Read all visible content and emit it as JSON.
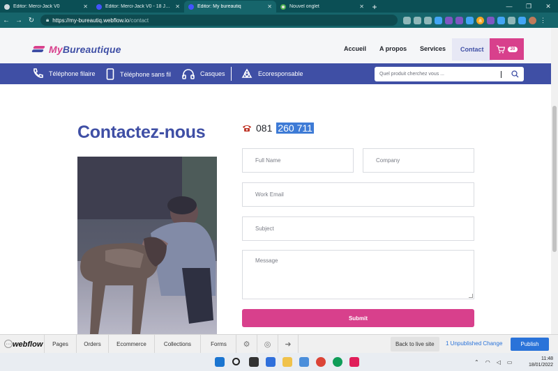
{
  "browser": {
    "tabs": [
      {
        "title": "Editor: Merci-Jack V0",
        "active": false
      },
      {
        "title": "Editor: Merci-Jack V0 - 18 Januar",
        "active": false
      },
      {
        "title": "Editor: My bureautiq",
        "active": true
      },
      {
        "title": "Nouvel onglet",
        "active": false
      }
    ],
    "url_host": "https://my-bureautiq.webflow.io",
    "url_path": "/contact",
    "new_tab": "+",
    "win_minimize": "—",
    "win_restore": "❐",
    "win_close": "✕",
    "ext_orange_label": "a"
  },
  "site": {
    "logo_part1": "My",
    "logo_part2": "Bureautique",
    "nav": [
      "Accueil",
      "A propos",
      "Services",
      "Contact"
    ],
    "cart_count": "20",
    "categories": [
      "Téléphone filaire",
      "Téléphone sans fil",
      "Casques",
      "Ecoresponsable"
    ],
    "search_placeholder": "Quel produit cherchez vous ...",
    "page_title": "Contactez-nous",
    "phone_prefix": "081",
    "phone_highlight": "260 711",
    "form": {
      "full_name": "Full Name",
      "company": "Company",
      "work_email": "Work Email",
      "subject": "Subject",
      "message": "Message",
      "submit": "Submit"
    }
  },
  "webflow": {
    "logo": "webflow",
    "menu": [
      "Pages",
      "Orders",
      "Ecommerce",
      "Collections",
      "Forms"
    ],
    "back_to_live": "Back to live site",
    "unpublished": "1 Unpublished Change",
    "publish": "Publish"
  },
  "taskbar": {
    "time": "11:48",
    "date": "18/01/2022"
  },
  "colors": {
    "brand_blue": "#3f4fa5",
    "brand_pink": "#d8408c",
    "browser_teal": "#16656b"
  }
}
